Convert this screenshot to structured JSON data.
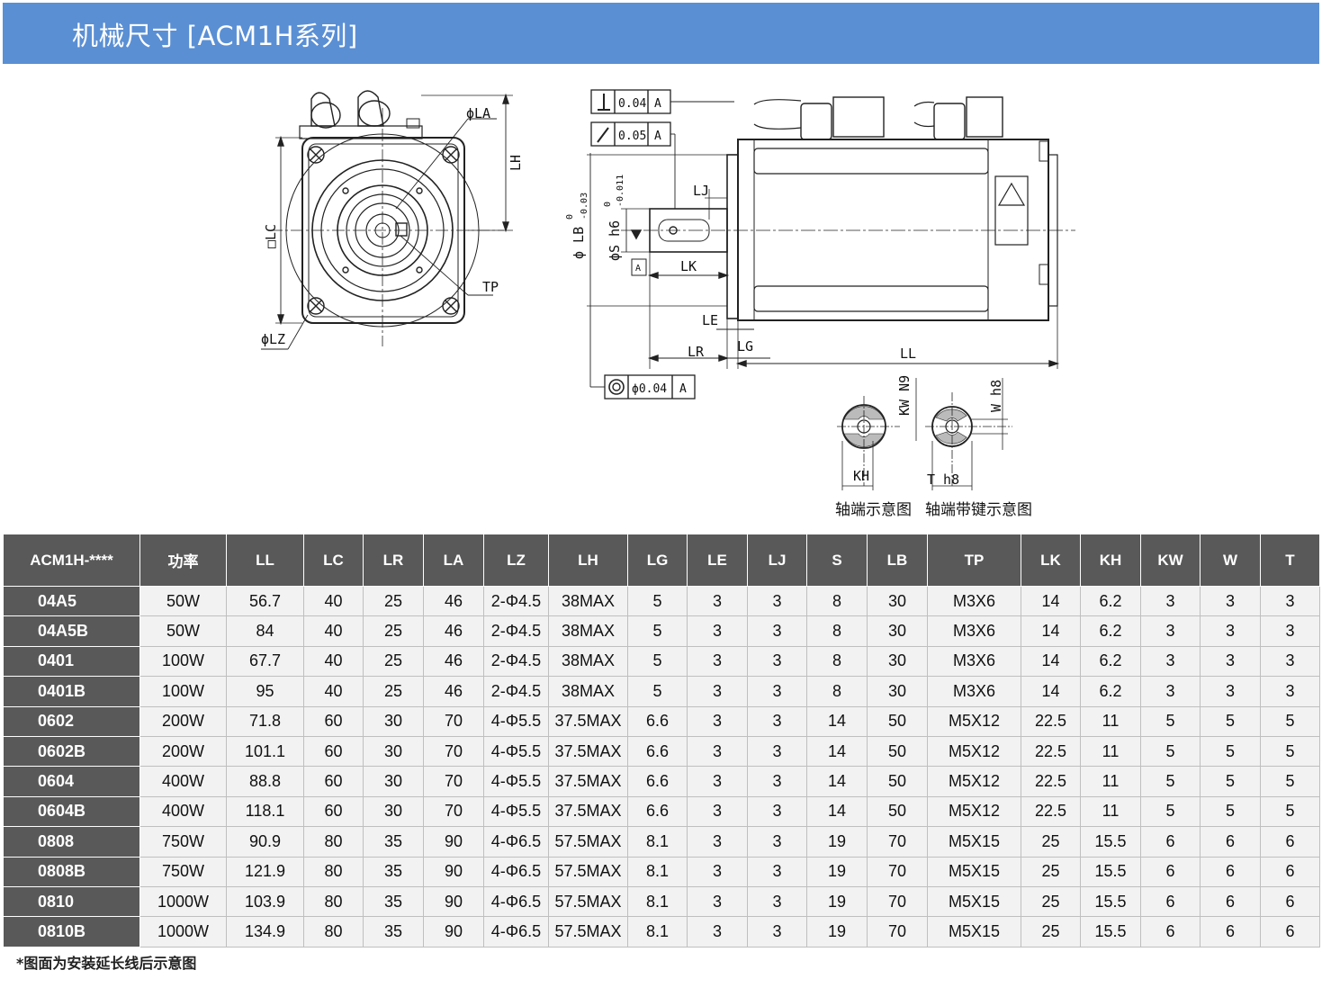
{
  "header": {
    "title": "机械尺寸 [ACM1H系列]"
  },
  "drawing": {
    "front_labels": {
      "la": "ϕLA",
      "lh": "LH",
      "lc": "□LC",
      "lz": "ϕLZ",
      "tp": "TP"
    },
    "side_labels": {
      "tol_perp": "0.04",
      "tol_runout": "0.05",
      "tol_conc": "ϕ0.04",
      "datum": "A",
      "lj": "LJ",
      "lk": "LK",
      "le": "LE",
      "lr": "LR",
      "lg": "LG",
      "ll": "LL",
      "lb": "ϕ LB",
      "lb_tol_up": "0",
      "lb_tol_low": "-0.03",
      "s": "ϕS h6",
      "s_tol_up": "0",
      "s_tol_low": "-0.011"
    },
    "shaft_labels": {
      "kh": "KH",
      "kw": "KW N9",
      "w": "W h8",
      "t": "T h8"
    },
    "captions": {
      "shaft_end": "轴端示意图",
      "shaft_key": "轴端带键示意图"
    }
  },
  "table": {
    "headers": [
      "ACM1H-****",
      "功率",
      "LL",
      "LC",
      "LR",
      "LA",
      "LZ",
      "LH",
      "LG",
      "LE",
      "LJ",
      "S",
      "LB",
      "TP",
      "LK",
      "KH",
      "KW",
      "W",
      "T"
    ],
    "rows": [
      [
        "04A5",
        "50W",
        "56.7",
        "40",
        "25",
        "46",
        "2-Φ4.5",
        "38MAX",
        "5",
        "3",
        "3",
        "8",
        "30",
        "M3X6",
        "14",
        "6.2",
        "3",
        "3",
        "3"
      ],
      [
        "04A5B",
        "50W",
        "84",
        "40",
        "25",
        "46",
        "2-Φ4.5",
        "38MAX",
        "5",
        "3",
        "3",
        "8",
        "30",
        "M3X6",
        "14",
        "6.2",
        "3",
        "3",
        "3"
      ],
      [
        "0401",
        "100W",
        "67.7",
        "40",
        "25",
        "46",
        "2-Φ4.5",
        "38MAX",
        "5",
        "3",
        "3",
        "8",
        "30",
        "M3X6",
        "14",
        "6.2",
        "3",
        "3",
        "3"
      ],
      [
        "0401B",
        "100W",
        "95",
        "40",
        "25",
        "46",
        "2-Φ4.5",
        "38MAX",
        "5",
        "3",
        "3",
        "8",
        "30",
        "M3X6",
        "14",
        "6.2",
        "3",
        "3",
        "3"
      ],
      [
        "0602",
        "200W",
        "71.8",
        "60",
        "30",
        "70",
        "4-Φ5.5",
        "37.5MAX",
        "6.6",
        "3",
        "3",
        "14",
        "50",
        "M5X12",
        "22.5",
        "11",
        "5",
        "5",
        "5"
      ],
      [
        "0602B",
        "200W",
        "101.1",
        "60",
        "30",
        "70",
        "4-Φ5.5",
        "37.5MAX",
        "6.6",
        "3",
        "3",
        "14",
        "50",
        "M5X12",
        "22.5",
        "11",
        "5",
        "5",
        "5"
      ],
      [
        "0604",
        "400W",
        "88.8",
        "60",
        "30",
        "70",
        "4-Φ5.5",
        "37.5MAX",
        "6.6",
        "3",
        "3",
        "14",
        "50",
        "M5X12",
        "22.5",
        "11",
        "5",
        "5",
        "5"
      ],
      [
        "0604B",
        "400W",
        "118.1",
        "60",
        "30",
        "70",
        "4-Φ5.5",
        "37.5MAX",
        "6.6",
        "3",
        "3",
        "14",
        "50",
        "M5X12",
        "22.5",
        "11",
        "5",
        "5",
        "5"
      ],
      [
        "0808",
        "750W",
        "90.9",
        "80",
        "35",
        "90",
        "4-Φ6.5",
        "57.5MAX",
        "8.1",
        "3",
        "3",
        "19",
        "70",
        "M5X15",
        "25",
        "15.5",
        "6",
        "6",
        "6"
      ],
      [
        "0808B",
        "750W",
        "121.9",
        "80",
        "35",
        "90",
        "4-Φ6.5",
        "57.5MAX",
        "8.1",
        "3",
        "3",
        "19",
        "70",
        "M5X15",
        "25",
        "15.5",
        "6",
        "6",
        "6"
      ],
      [
        "0810",
        "1000W",
        "103.9",
        "80",
        "35",
        "90",
        "4-Φ6.5",
        "57.5MAX",
        "8.1",
        "3",
        "3",
        "19",
        "70",
        "M5X15",
        "25",
        "15.5",
        "6",
        "6",
        "6"
      ],
      [
        "0810B",
        "1000W",
        "134.9",
        "80",
        "35",
        "90",
        "4-Φ6.5",
        "57.5MAX",
        "8.1",
        "3",
        "3",
        "19",
        "70",
        "M5X15",
        "25",
        "15.5",
        "6",
        "6",
        "6"
      ]
    ]
  },
  "footnote": "*图面为安装延长线后示意图"
}
